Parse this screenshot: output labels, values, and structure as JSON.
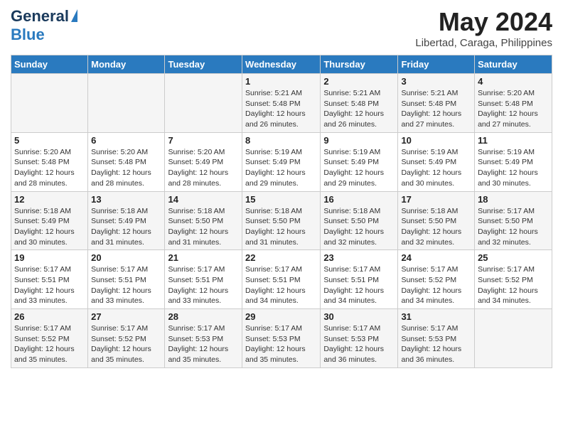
{
  "header": {
    "logo_line1": "General",
    "logo_line2": "Blue",
    "month_title": "May 2024",
    "subtitle": "Libertad, Caraga, Philippines"
  },
  "days_of_week": [
    "Sunday",
    "Monday",
    "Tuesday",
    "Wednesday",
    "Thursday",
    "Friday",
    "Saturday"
  ],
  "weeks": [
    [
      {
        "day": "",
        "info": ""
      },
      {
        "day": "",
        "info": ""
      },
      {
        "day": "",
        "info": ""
      },
      {
        "day": "1",
        "info": "Sunrise: 5:21 AM\nSunset: 5:48 PM\nDaylight: 12 hours and 26 minutes."
      },
      {
        "day": "2",
        "info": "Sunrise: 5:21 AM\nSunset: 5:48 PM\nDaylight: 12 hours and 26 minutes."
      },
      {
        "day": "3",
        "info": "Sunrise: 5:21 AM\nSunset: 5:48 PM\nDaylight: 12 hours and 27 minutes."
      },
      {
        "day": "4",
        "info": "Sunrise: 5:20 AM\nSunset: 5:48 PM\nDaylight: 12 hours and 27 minutes."
      }
    ],
    [
      {
        "day": "5",
        "info": "Sunrise: 5:20 AM\nSunset: 5:48 PM\nDaylight: 12 hours and 28 minutes."
      },
      {
        "day": "6",
        "info": "Sunrise: 5:20 AM\nSunset: 5:48 PM\nDaylight: 12 hours and 28 minutes."
      },
      {
        "day": "7",
        "info": "Sunrise: 5:20 AM\nSunset: 5:49 PM\nDaylight: 12 hours and 28 minutes."
      },
      {
        "day": "8",
        "info": "Sunrise: 5:19 AM\nSunset: 5:49 PM\nDaylight: 12 hours and 29 minutes."
      },
      {
        "day": "9",
        "info": "Sunrise: 5:19 AM\nSunset: 5:49 PM\nDaylight: 12 hours and 29 minutes."
      },
      {
        "day": "10",
        "info": "Sunrise: 5:19 AM\nSunset: 5:49 PM\nDaylight: 12 hours and 30 minutes."
      },
      {
        "day": "11",
        "info": "Sunrise: 5:19 AM\nSunset: 5:49 PM\nDaylight: 12 hours and 30 minutes."
      }
    ],
    [
      {
        "day": "12",
        "info": "Sunrise: 5:18 AM\nSunset: 5:49 PM\nDaylight: 12 hours and 30 minutes."
      },
      {
        "day": "13",
        "info": "Sunrise: 5:18 AM\nSunset: 5:49 PM\nDaylight: 12 hours and 31 minutes."
      },
      {
        "day": "14",
        "info": "Sunrise: 5:18 AM\nSunset: 5:50 PM\nDaylight: 12 hours and 31 minutes."
      },
      {
        "day": "15",
        "info": "Sunrise: 5:18 AM\nSunset: 5:50 PM\nDaylight: 12 hours and 31 minutes."
      },
      {
        "day": "16",
        "info": "Sunrise: 5:18 AM\nSunset: 5:50 PM\nDaylight: 12 hours and 32 minutes."
      },
      {
        "day": "17",
        "info": "Sunrise: 5:18 AM\nSunset: 5:50 PM\nDaylight: 12 hours and 32 minutes."
      },
      {
        "day": "18",
        "info": "Sunrise: 5:17 AM\nSunset: 5:50 PM\nDaylight: 12 hours and 32 minutes."
      }
    ],
    [
      {
        "day": "19",
        "info": "Sunrise: 5:17 AM\nSunset: 5:51 PM\nDaylight: 12 hours and 33 minutes."
      },
      {
        "day": "20",
        "info": "Sunrise: 5:17 AM\nSunset: 5:51 PM\nDaylight: 12 hours and 33 minutes."
      },
      {
        "day": "21",
        "info": "Sunrise: 5:17 AM\nSunset: 5:51 PM\nDaylight: 12 hours and 33 minutes."
      },
      {
        "day": "22",
        "info": "Sunrise: 5:17 AM\nSunset: 5:51 PM\nDaylight: 12 hours and 34 minutes."
      },
      {
        "day": "23",
        "info": "Sunrise: 5:17 AM\nSunset: 5:51 PM\nDaylight: 12 hours and 34 minutes."
      },
      {
        "day": "24",
        "info": "Sunrise: 5:17 AM\nSunset: 5:52 PM\nDaylight: 12 hours and 34 minutes."
      },
      {
        "day": "25",
        "info": "Sunrise: 5:17 AM\nSunset: 5:52 PM\nDaylight: 12 hours and 34 minutes."
      }
    ],
    [
      {
        "day": "26",
        "info": "Sunrise: 5:17 AM\nSunset: 5:52 PM\nDaylight: 12 hours and 35 minutes."
      },
      {
        "day": "27",
        "info": "Sunrise: 5:17 AM\nSunset: 5:52 PM\nDaylight: 12 hours and 35 minutes."
      },
      {
        "day": "28",
        "info": "Sunrise: 5:17 AM\nSunset: 5:53 PM\nDaylight: 12 hours and 35 minutes."
      },
      {
        "day": "29",
        "info": "Sunrise: 5:17 AM\nSunset: 5:53 PM\nDaylight: 12 hours and 35 minutes."
      },
      {
        "day": "30",
        "info": "Sunrise: 5:17 AM\nSunset: 5:53 PM\nDaylight: 12 hours and 36 minutes."
      },
      {
        "day": "31",
        "info": "Sunrise: 5:17 AM\nSunset: 5:53 PM\nDaylight: 12 hours and 36 minutes."
      },
      {
        "day": "",
        "info": ""
      }
    ]
  ]
}
